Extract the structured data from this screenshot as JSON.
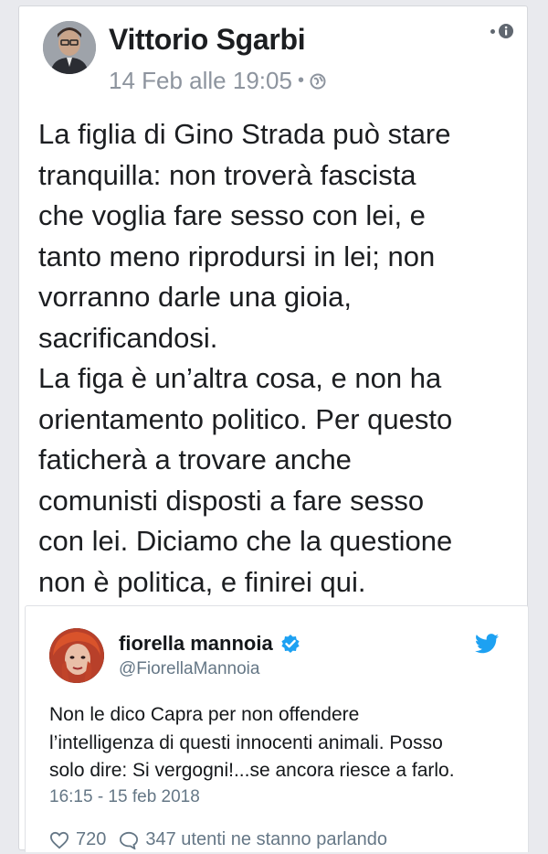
{
  "post": {
    "author_name": "Vittorio Sgarbi",
    "timestamp": "14 Feb alle 19:05",
    "separator": "•",
    "privacy_icon": "globe-icon",
    "text": "La figlia di Gino Strada può stare\ntranquilla: non troverà fascista\nche voglia fare sesso con lei, e\ntanto meno riprodursi in lei; non\nvorranno darle una gioia,\nsacrificandosi.\nLa figa è un’altra cosa, e  non ha\norientamento politico. Per questo\nfaticherà a trovare anche\ncomunisti disposti a fare sesso\ncon lei. Diciamo che la questione\nnon è politica, e finirei qui."
  },
  "embedded_tweet": {
    "display_name": "fiorella mannoia",
    "handle": "@FiorellaMannoia",
    "verified_icon": "verified-badge-icon",
    "bird_icon": "twitter-bird-icon",
    "text": "Non le dico Capra per non offendere\nl’intelligenza di questi innocenti animali. Posso\nsolo dire: Si vergogni!...se ancora riesce a farlo.",
    "time": "16:15 - 15 feb 2018",
    "likes": "720",
    "replies_text": "347 utenti ne stanno parlando"
  },
  "colors": {
    "twitter_blue": "#1da1f2",
    "muted_text": "#8d949e",
    "tweet_muted": "#657786"
  }
}
